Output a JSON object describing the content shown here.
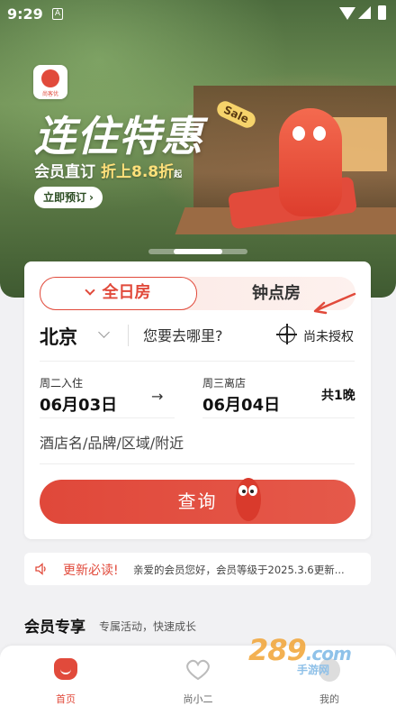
{
  "status_bar": {
    "time": "9:29",
    "sim_glyph": "A"
  },
  "app_logo_text": "尚客优",
  "hero": {
    "title": "连住特惠",
    "sale_tag": "Sale",
    "subtitle": "会员直订",
    "promo": "折上8.8折",
    "promo_suffix": "起",
    "cta": "立即预订"
  },
  "booking": {
    "tabs": [
      "全日房",
      "钟点房"
    ],
    "active_tab_index": 0,
    "city": "北京",
    "destination_placeholder": "您要去哪里?",
    "location_status": "尚未授权",
    "check_in_label": "周二入住",
    "check_in_date": "06月03日",
    "check_out_label": "周三离店",
    "check_out_date": "06月04日",
    "nights": "共1晚",
    "keyword_placeholder": "酒店名/品牌/区域/附近",
    "search_button": "查询"
  },
  "notice": {
    "title": "更新必读!",
    "text": "亲爱的会员您好，会员等级于2025.3.6更新..."
  },
  "member_section": {
    "title": "会员专享",
    "subtitle": "专属活动，快速成长"
  },
  "tab_bar": [
    {
      "label": "首页",
      "icon": "home-icon",
      "active": true
    },
    {
      "label": "尚小二",
      "icon": "heart-icon",
      "active": false
    },
    {
      "label": "我的",
      "icon": "profile-icon",
      "active": false
    }
  ],
  "watermark": {
    "brand": "289",
    "domain": ".com",
    "sub": "手游网"
  },
  "colors": {
    "accent": "#e14a3b",
    "hero_green": "#5f7d48",
    "promo_yellow": "#ffe07a"
  }
}
